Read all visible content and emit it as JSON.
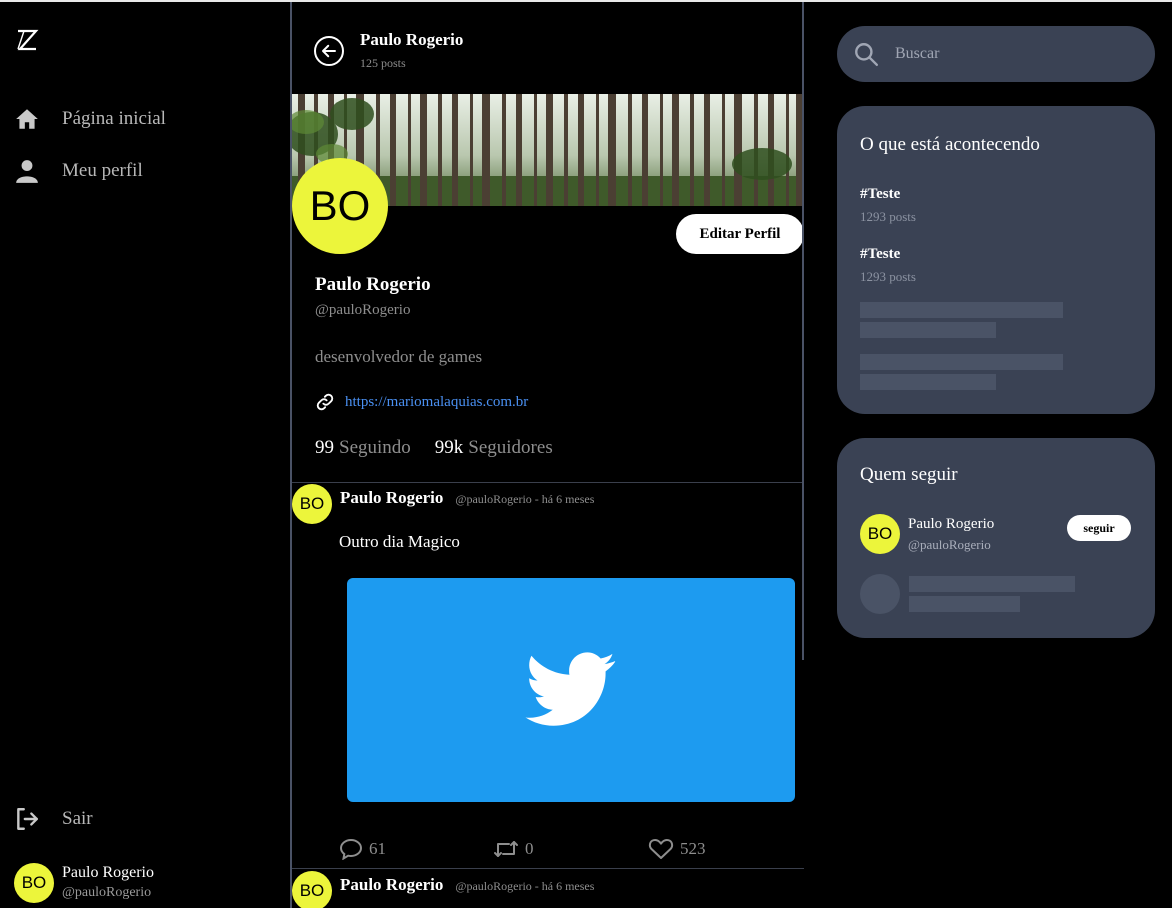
{
  "sidebar": {
    "logo_icon": "z-logo",
    "items": [
      {
        "label": "Página inicial",
        "icon": "home-icon"
      },
      {
        "label": "Meu perfil",
        "icon": "user-icon"
      }
    ],
    "logout_label": "Sair",
    "user": {
      "initials": "BO",
      "name": "Paulo Rogerio",
      "handle": "@pauloRogerio"
    }
  },
  "header": {
    "title": "Paulo Rogerio",
    "post_count": "125 posts"
  },
  "profile": {
    "initials": "BO",
    "edit_label": "Editar Perfil",
    "name": "Paulo Rogerio",
    "handle": "@pauloRogerio",
    "bio": "desenvolvedor de games",
    "link": "https://mariomalaquias.com.br",
    "following_count": "99",
    "following_label": "Seguindo",
    "followers_count": "99k",
    "followers_label": "Seguidores"
  },
  "posts": [
    {
      "initials": "BO",
      "author": "Paulo Rogerio",
      "meta": "@pauloRogerio - há 6 meses",
      "text": "Outro dia Magico",
      "media_icon": "twitter-bird-icon",
      "comments": "61",
      "retweets": "0",
      "likes": "523"
    },
    {
      "initials": "BO",
      "author": "Paulo Rogerio",
      "meta": "@pauloRogerio - há 6 meses"
    }
  ],
  "search": {
    "placeholder": "Buscar"
  },
  "trends": {
    "title": "O que está acontecendo",
    "items": [
      {
        "tag": "#Teste",
        "count": "1293 posts"
      },
      {
        "tag": "#Teste",
        "count": "1293 posts"
      }
    ]
  },
  "who_to_follow": {
    "title": "Quem seguir",
    "user": {
      "initials": "BO",
      "name": "Paulo Rogerio",
      "handle": "@pauloRogerio"
    },
    "follow_label": "seguir"
  },
  "colors": {
    "accent_avatar": "#ecf53b",
    "card_bg": "#3a4254",
    "link": "#4a90f2",
    "media_bg": "#1d9bf0"
  }
}
